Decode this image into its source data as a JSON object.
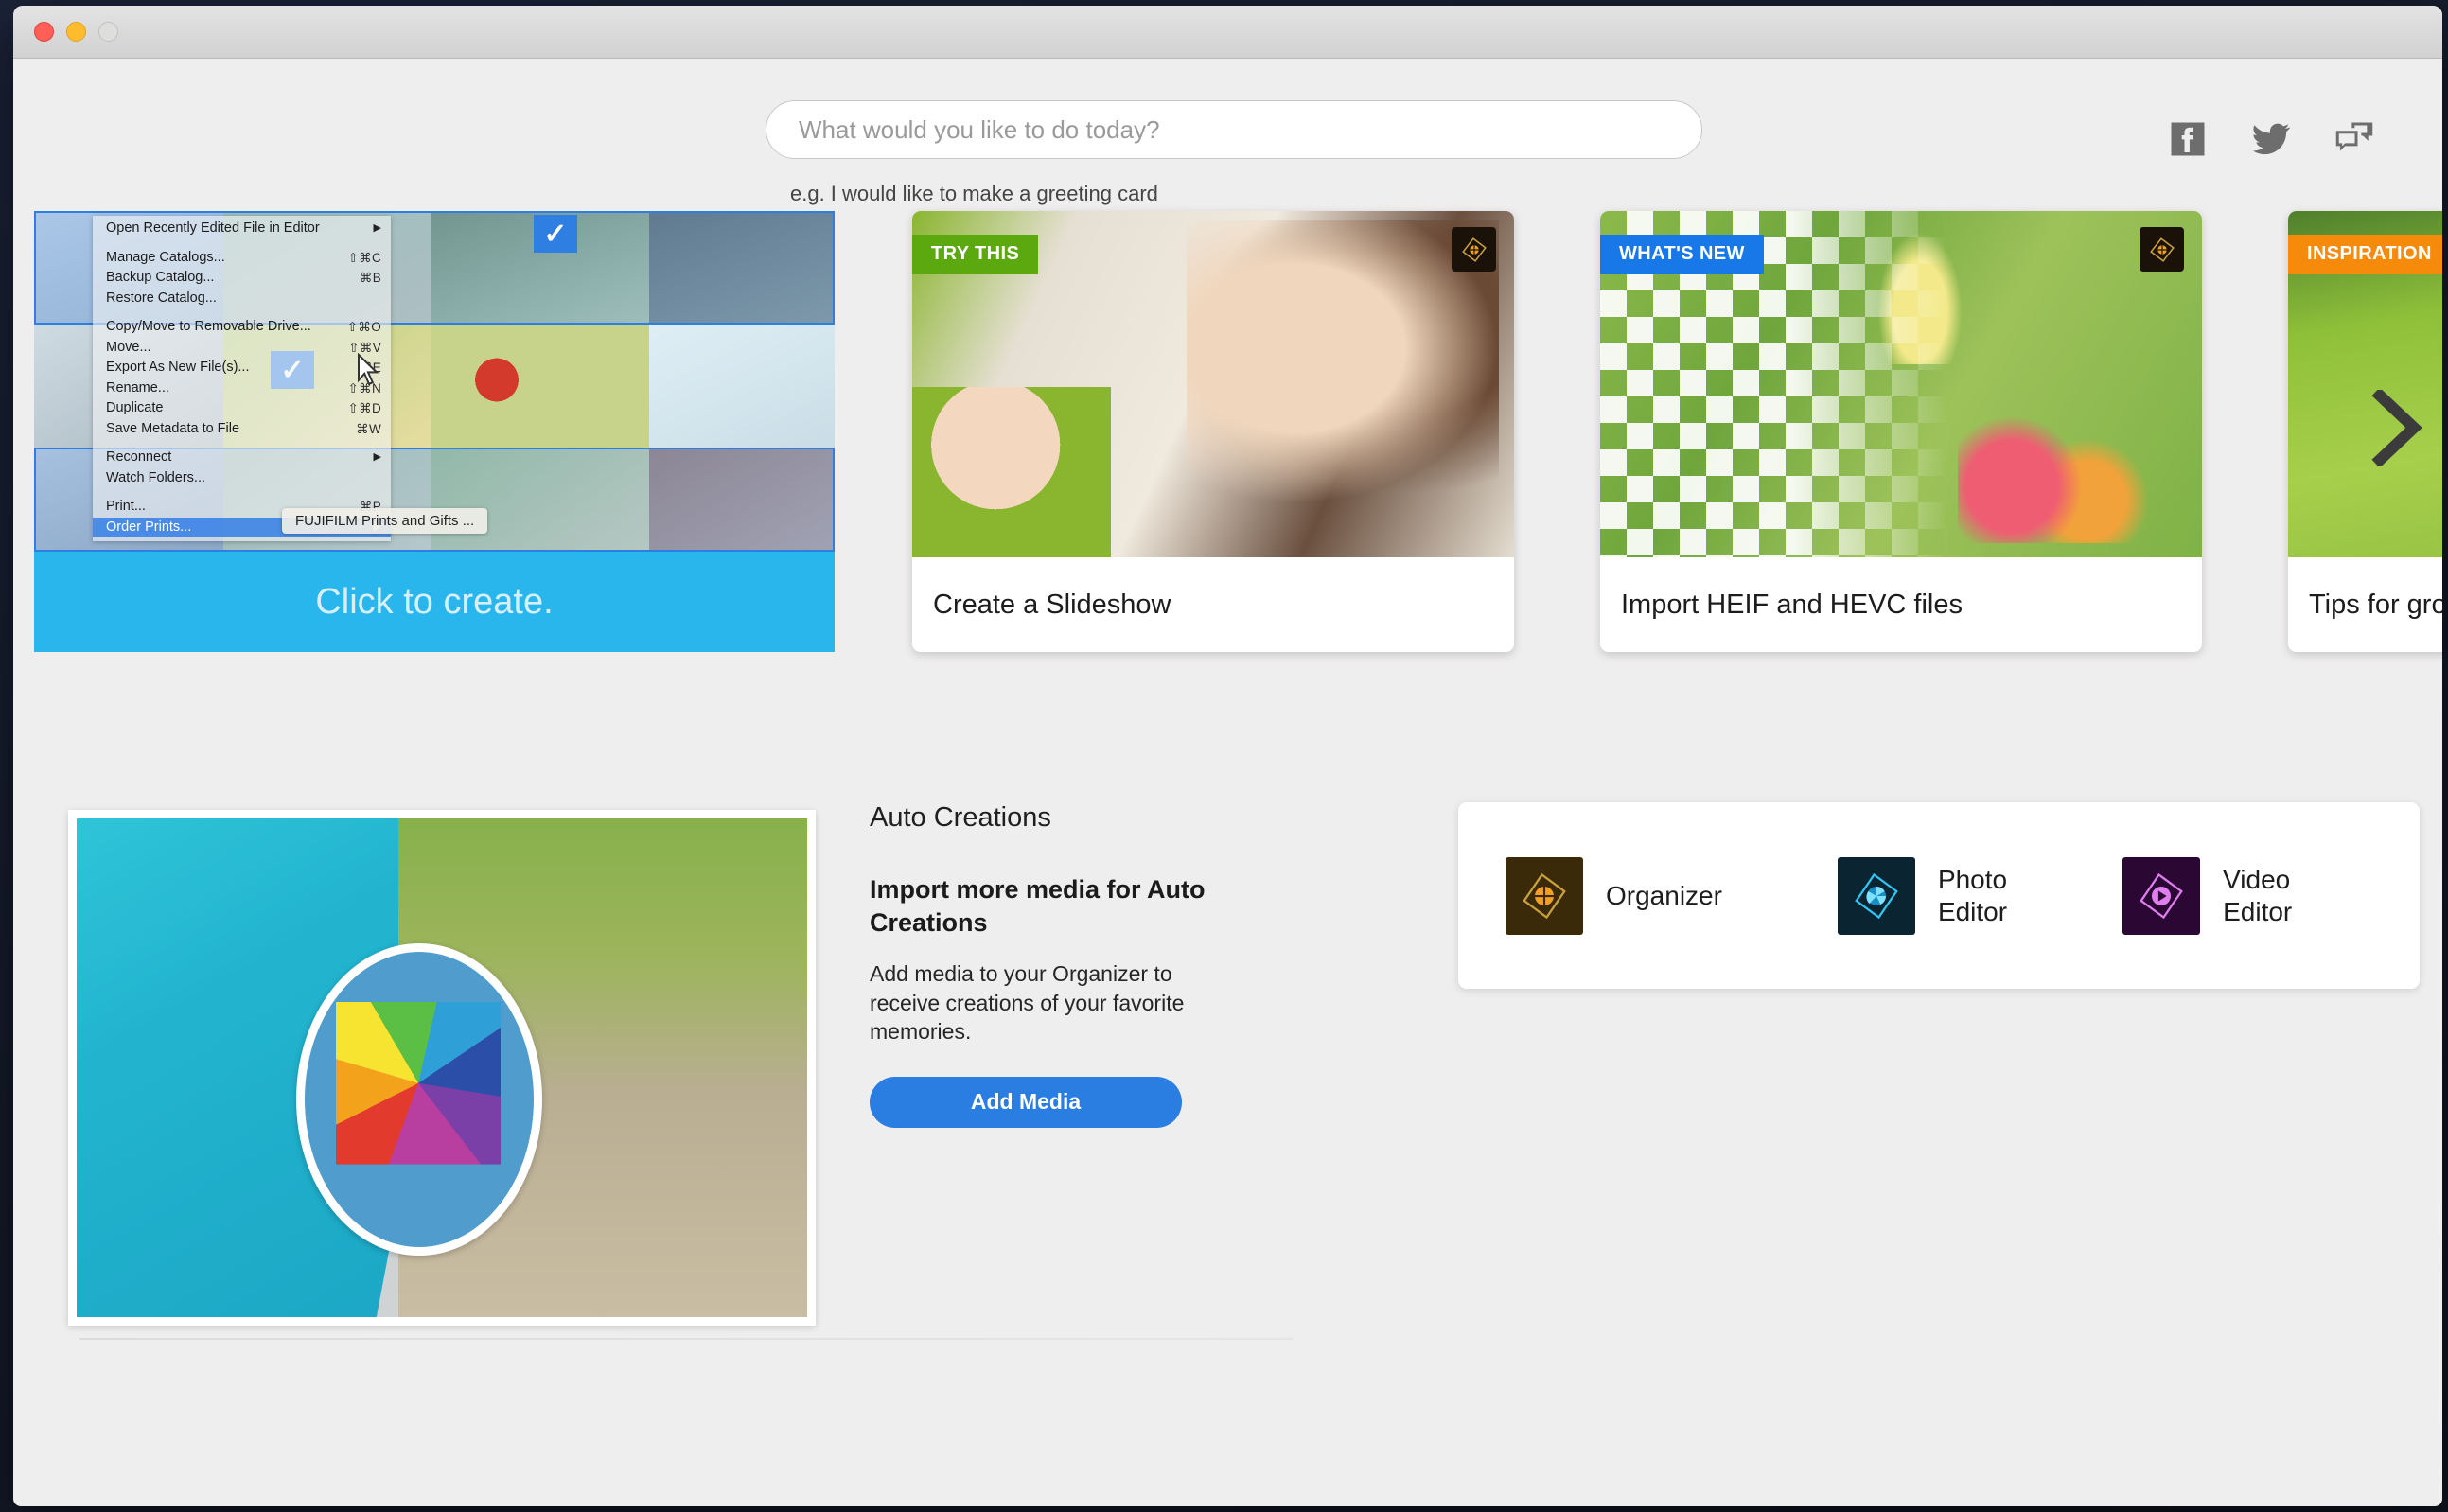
{
  "window": {
    "controls": [
      "close",
      "minimize",
      "zoom"
    ]
  },
  "search": {
    "placeholder": "What would you like to do today?",
    "value": "",
    "hint": "e.g. I would like to make a greeting card"
  },
  "social": [
    {
      "name": "facebook-icon",
      "label": "Facebook"
    },
    {
      "name": "twitter-icon",
      "label": "Twitter"
    },
    {
      "name": "community-icon",
      "label": "Community"
    }
  ],
  "carousel": {
    "create_card": {
      "banner_text": "Click to create.",
      "submenu_item": "FUJIFILM Prints and Gifts ...",
      "menu_items": [
        {
          "label": "Open Recently Edited File in Editor",
          "shortcut": "",
          "submenu": true,
          "selected": false
        },
        {
          "separator": true
        },
        {
          "label": "Manage Catalogs...",
          "shortcut": "⇧⌘C",
          "submenu": false,
          "selected": false
        },
        {
          "label": "Backup Catalog...",
          "shortcut": "⌘B",
          "submenu": false,
          "selected": false
        },
        {
          "label": "Restore Catalog...",
          "shortcut": "",
          "submenu": false,
          "selected": false
        },
        {
          "separator": true
        },
        {
          "label": "Copy/Move to Removable Drive...",
          "shortcut": "⇧⌘O",
          "submenu": false,
          "selected": false
        },
        {
          "label": "Move...",
          "shortcut": "⇧⌘V",
          "submenu": false,
          "selected": false
        },
        {
          "label": "Export As New File(s)...",
          "shortcut": "⌘E",
          "submenu": false,
          "selected": false
        },
        {
          "label": "Rename...",
          "shortcut": "⇧⌘N",
          "submenu": false,
          "selected": false
        },
        {
          "label": "Duplicate",
          "shortcut": "⇧⌘D",
          "submenu": false,
          "selected": false
        },
        {
          "label": "Save Metadata to File",
          "shortcut": "⌘W",
          "submenu": false,
          "selected": false
        },
        {
          "separator": true
        },
        {
          "label": "Reconnect",
          "shortcut": "",
          "submenu": true,
          "selected": false
        },
        {
          "label": "Watch Folders...",
          "shortcut": "",
          "submenu": false,
          "selected": false
        },
        {
          "separator": true
        },
        {
          "label": "Print...",
          "shortcut": "⌘P",
          "submenu": false,
          "selected": false
        },
        {
          "label": "Order Prints...",
          "shortcut": "",
          "submenu": true,
          "selected": true
        }
      ]
    },
    "cards": [
      {
        "badge": "TRY THIS",
        "badge_color": "#5ba80f",
        "badge_style": "green",
        "title": "Create a Slideshow"
      },
      {
        "badge": "WHAT'S NEW",
        "badge_color": "#1878e8",
        "badge_style": "blue",
        "title": "Import HEIF and HEVC files"
      },
      {
        "badge": "INSPIRATION",
        "badge_color": "#f58a0b",
        "badge_style": "orange",
        "title": "Tips for gro"
      }
    ],
    "next_label": "Next"
  },
  "auto_creations": {
    "section_title": "Auto Creations",
    "heading": "Import more media for Auto Creations",
    "body": "Add media to your Organizer to receive creations of your favorite memories.",
    "button_label": "Add Media"
  },
  "apps": [
    {
      "name": "Organizer",
      "line1": "Organizer",
      "line2": "",
      "color": "#f0a024"
    },
    {
      "name": "Photo Editor",
      "line1": "Photo",
      "line2": "Editor",
      "color": "#31c5f3"
    },
    {
      "name": "Video Editor",
      "line1": "Video",
      "line2": "Editor",
      "color": "#e07ef0"
    }
  ],
  "colors": {
    "accent_blue": "#2a7de1",
    "banner_cyan": "#29b6ec",
    "window_bg": "#efeeee"
  }
}
